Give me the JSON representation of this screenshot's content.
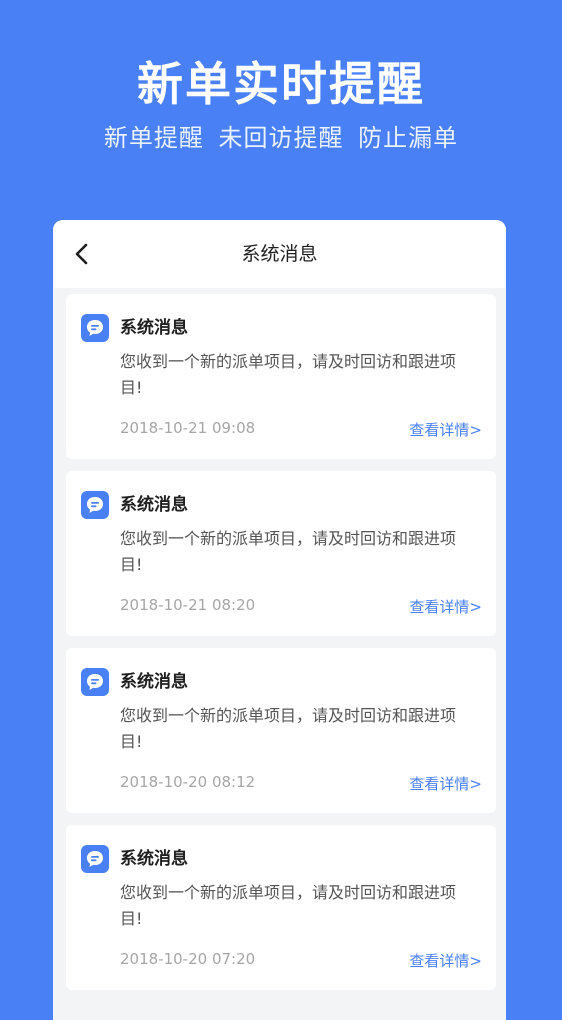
{
  "hero": {
    "title": "新单实时提醒",
    "subtitle": "新单提醒  未回访提醒  防止漏单"
  },
  "colors": {
    "background": "#4a80f5",
    "accent": "#4a80f5",
    "card": "#ffffff"
  },
  "nav": {
    "back_icon": "chevron-left-icon",
    "title": "系统消息"
  },
  "messages": [
    {
      "icon": "chat-bubble-icon",
      "title": "系统消息",
      "body": "您收到一个新的派单项目，请及时回访和跟进项目!",
      "time": "2018-10-21 09:08",
      "link": "查看详情>"
    },
    {
      "icon": "chat-bubble-icon",
      "title": "系统消息",
      "body": "您收到一个新的派单项目，请及时回访和跟进项目!",
      "time": "2018-10-21 08:20",
      "link": "查看详情>"
    },
    {
      "icon": "chat-bubble-icon",
      "title": "系统消息",
      "body": "您收到一个新的派单项目，请及时回访和跟进项目!",
      "time": "2018-10-20 08:12",
      "link": "查看详情>"
    },
    {
      "icon": "chat-bubble-icon",
      "title": "系统消息",
      "body": "您收到一个新的派单项目，请及时回访和跟进项目!",
      "time": "2018-10-20 07:20",
      "link": "查看详情>"
    }
  ]
}
